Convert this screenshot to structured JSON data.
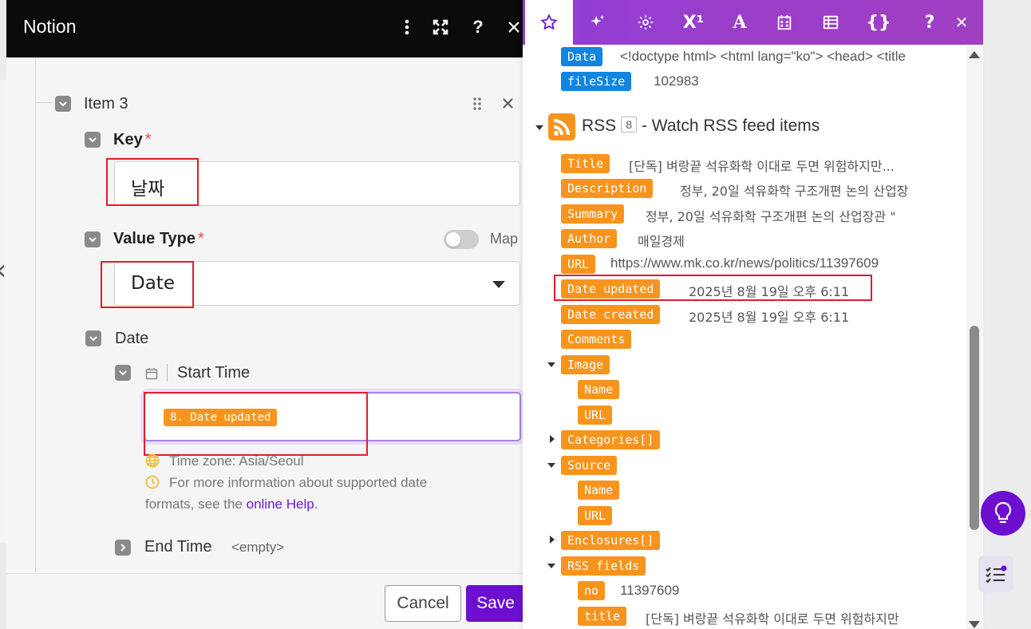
{
  "modal": {
    "title": "Notion",
    "item_label": "Item 3",
    "key_label": "Key",
    "key_required": "*",
    "key_value": "날짜",
    "value_type_label": "Value Type",
    "value_type_required": "*",
    "map_label": "Map",
    "value_type_selected": "Date",
    "date_label": "Date",
    "start_time_label": "Start Time",
    "start_time_pill": "8. Date updated",
    "timezone_text": "Time zone: Asia/Seoul",
    "help_text_1": "For more information about supported date",
    "help_text_2": "formats, see the",
    "help_link": "online Help",
    "help_period": ".",
    "end_time_label": "End Time",
    "end_time_value": "<empty>",
    "cancel_label": "Cancel",
    "save_label": "Save"
  },
  "panel": {
    "toolbar_sup_label": "X¹",
    "toolbar_text_label": "A",
    "toolbar_braces_label": "{}",
    "toolbar_help_label": "?",
    "toolbar_close_label": "✕",
    "top_rows": [
      {
        "key": "Data",
        "value": "<!doctype html> <html lang=\"ko\"> <head> <title"
      },
      {
        "key": "fileSize",
        "value": "102983"
      }
    ],
    "module_name": "RSS",
    "module_number": "8",
    "module_desc": "- Watch RSS feed items",
    "rows": [
      {
        "key": "Title",
        "value": "[단독] 벼랑끝 석유화학 이대로 두면 위험하지만..."
      },
      {
        "key": "Description",
        "value": "정부, 20일 석유화학 구조개편 논의 산업장"
      },
      {
        "key": "Summary",
        "value": "정부, 20일 석유화학 구조개편 논의 산업장관 \""
      },
      {
        "key": "Author",
        "value": "매일경제"
      },
      {
        "key": "URL",
        "value": "https://www.mk.co.kr/news/politics/11397609"
      },
      {
        "key": "Date updated",
        "value": "2025년 8월 19일 오후 6:11"
      },
      {
        "key": "Date created",
        "value": "2025년 8월 19일 오후 6:11"
      },
      {
        "key": "Comments",
        "value": ""
      },
      {
        "key": "Image",
        "value": ""
      },
      {
        "key": "Name",
        "value": ""
      },
      {
        "key": "URL",
        "value": ""
      },
      {
        "key": "Categories[]",
        "value": ""
      },
      {
        "key": "Source",
        "value": ""
      },
      {
        "key": "Name",
        "value": ""
      },
      {
        "key": "URL",
        "value": ""
      },
      {
        "key": "Enclosures[]",
        "value": ""
      },
      {
        "key": "RSS fields",
        "value": ""
      },
      {
        "key": "no",
        "value": "11397609"
      },
      {
        "key": "title",
        "value": "[단독] 벼랑끝 석유화학 이대로 두면 위험하지만"
      }
    ]
  },
  "colors": {
    "accent": "#6c0fcf",
    "pill_orange": "#f7941d",
    "pill_blue": "#1285e0",
    "highlight_red": "#e11d2a"
  }
}
